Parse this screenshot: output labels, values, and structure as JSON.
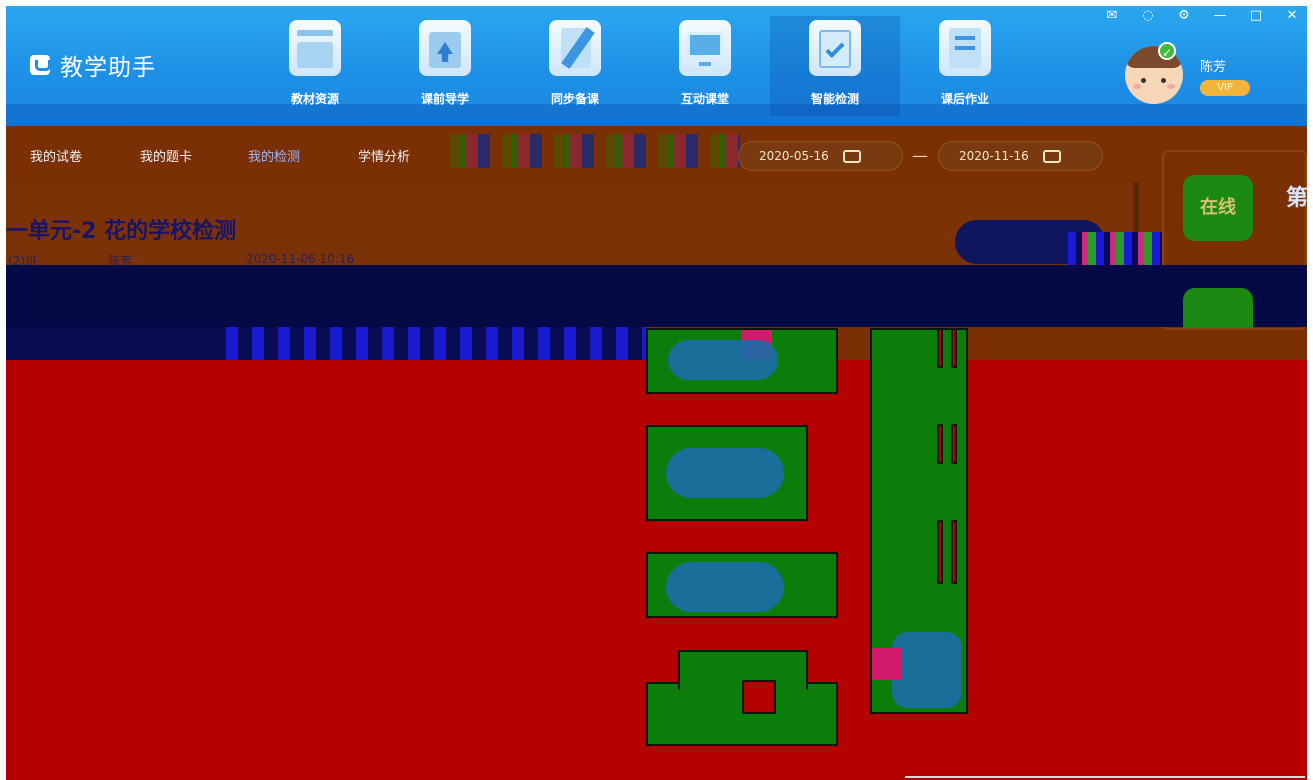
{
  "app": {
    "title": "教学助手"
  },
  "nav": [
    {
      "label": "教材资源",
      "icon": "textbook-resource-icon"
    },
    {
      "label": "课前导学",
      "icon": "preview-guide-icon"
    },
    {
      "label": "同步备课",
      "icon": "lesson-prep-icon"
    },
    {
      "label": "互动课堂",
      "icon": "interactive-class-icon"
    },
    {
      "label": "智能检测",
      "icon": "smart-test-icon",
      "active": true
    },
    {
      "label": "课后作业",
      "icon": "homework-icon"
    }
  ],
  "window_controls": [
    "mail-icon",
    "bell-icon",
    "settings-icon",
    "minimize-icon",
    "maximize-icon",
    "close-icon"
  ],
  "user": {
    "name": "陈芳",
    "role_badge": "VIP"
  },
  "tabs": [
    {
      "label": "我的试卷"
    },
    {
      "label": "我的题卡"
    },
    {
      "label": "我的检测",
      "active": true
    },
    {
      "label": "学情分析"
    }
  ],
  "filter": {
    "start_date": "2020-05-16",
    "end_date": "2020-11-16",
    "separator": "—"
  },
  "exam": {
    "title": "一单元-2 花的学校检测",
    "class": "(2)班",
    "author": "陈芳",
    "time": "2020-11-06 10:16"
  },
  "side": {
    "button_label": "在线",
    "edge_char": "第"
  },
  "colors": {
    "header": "#1d8fe6",
    "accent_badge": "#f2b43a",
    "active_tab": "#9fb6ff"
  }
}
